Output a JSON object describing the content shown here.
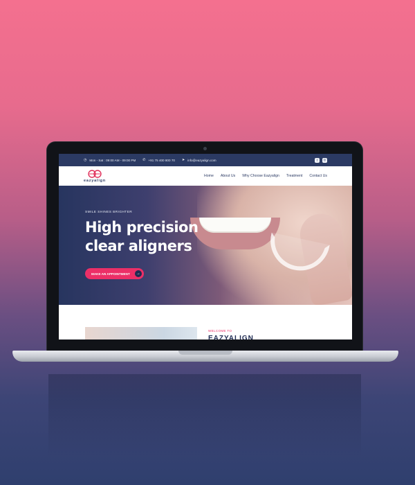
{
  "topbar": {
    "hours": "Mon - Sat : 09:00 AM - 09:00 PM",
    "phone": "+91 75 400 800 70",
    "email": "info@eazyalign.com",
    "social": [
      "facebook-icon",
      "instagram-icon"
    ]
  },
  "nav": {
    "logo_text": "eazyalign",
    "menu": [
      "Home",
      "About Us",
      "Why Choose Eazyalign",
      "Treatment",
      "Contact Us"
    ]
  },
  "hero": {
    "eyebrow": "SMILE SHINES BRIGHTER",
    "headline": "High precision clear aligners",
    "cta_label": "MAKE AN APPOINTMENT"
  },
  "section": {
    "welcome": "WELCOME TO",
    "brand": "EAZYALIGN"
  },
  "colors": {
    "accent": "#ec2f67",
    "navy": "#2b3a63"
  }
}
